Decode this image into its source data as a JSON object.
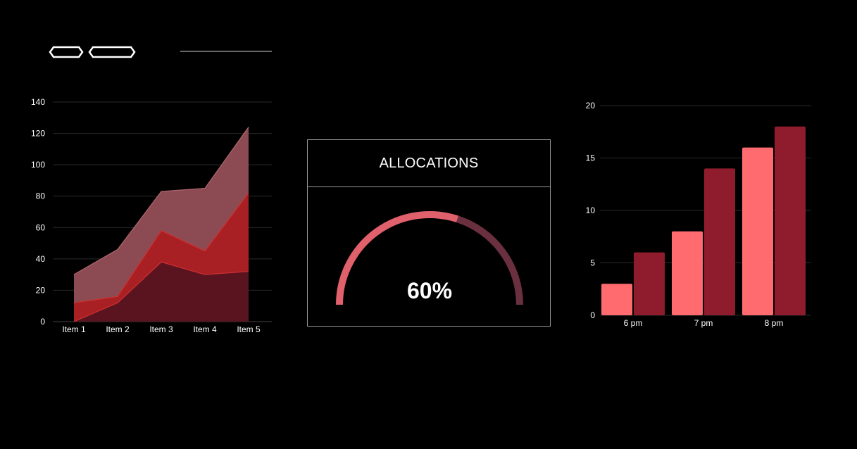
{
  "colors": {
    "background": "#000000",
    "gridline": "#2a2a2a",
    "area_series_1": "#8c4a52",
    "area_series_2": "#a82024",
    "area_series_3": "#5a1420",
    "bar_series_1": "#ff6b6e",
    "bar_series_2": "#8f1c2c",
    "gauge_filled": "#e0606b",
    "gauge_track": "#6a3040"
  },
  "toolbar": {
    "shape_1_icon": "hexagon-outline-icon",
    "shape_2_icon": "hexagon-outline-icon",
    "divider": "line"
  },
  "gauge": {
    "title": "ALLOCATIONS",
    "value_label": "60%",
    "percent": 60
  },
  "chart_data": [
    {
      "type": "area",
      "stacked": true,
      "categories": [
        "Item 1",
        "Item 2",
        "Item 3",
        "Item 4",
        "Item 5"
      ],
      "series": [
        {
          "values": [
            0,
            12,
            38,
            30,
            32
          ],
          "color": "#5a1420"
        },
        {
          "values": [
            12,
            4,
            20,
            15,
            50
          ],
          "color": "#a82024"
        },
        {
          "values": [
            18,
            30,
            25,
            40,
            42
          ],
          "color": "#8c4a52"
        }
      ],
      "ylim": [
        0,
        140
      ],
      "yticks": [
        "0",
        "20",
        "40",
        "60",
        "80",
        "100",
        "120",
        "140"
      ],
      "grid": true,
      "title": "",
      "xlabel": "",
      "ylabel": ""
    },
    {
      "type": "bar",
      "categories": [
        "6 pm",
        "7 pm",
        "8 pm"
      ],
      "series": [
        {
          "values": [
            3,
            8,
            16
          ],
          "color": "#ff6b6e"
        },
        {
          "values": [
            6,
            14,
            18
          ],
          "color": "#8f1c2c"
        }
      ],
      "ylim": [
        0,
        20
      ],
      "yticks": [
        "0",
        "5",
        "10",
        "15",
        "20"
      ],
      "grid": true,
      "title": "",
      "xlabel": "",
      "ylabel": ""
    }
  ]
}
